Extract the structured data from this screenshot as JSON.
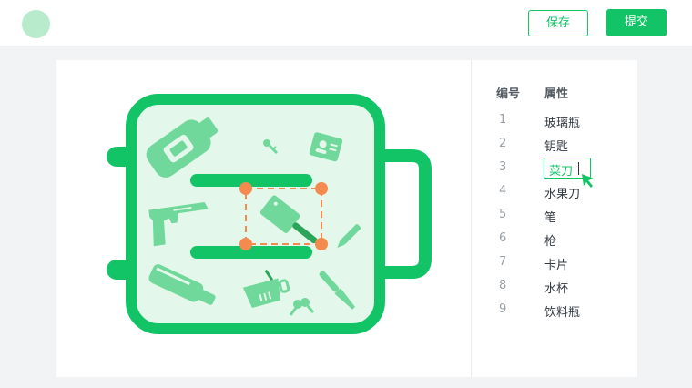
{
  "header": {
    "save_label": "保存",
    "submit_label": "提交"
  },
  "table": {
    "col_number": "编号",
    "col_attribute": "属性",
    "rows": [
      {
        "num": "1",
        "value": "玻璃瓶"
      },
      {
        "num": "2",
        "value": "钥匙"
      },
      {
        "num": "3",
        "value": "菜刀"
      },
      {
        "num": "4",
        "value": "水果刀"
      },
      {
        "num": "5",
        "value": "笔"
      },
      {
        "num": "6",
        "value": "枪"
      },
      {
        "num": "7",
        "value": "卡片"
      },
      {
        "num": "8",
        "value": "水杯"
      },
      {
        "num": "9",
        "value": "饮料瓶"
      }
    ],
    "editing_row": 3
  },
  "colors": {
    "accent": "#13c466",
    "accent_light": "#e3f7ea",
    "item_fill": "#6fd89a",
    "selection_handle": "#f58a4e"
  },
  "icons": [
    "bottle-icon",
    "key-icon",
    "id-card-icon",
    "pistol-icon",
    "cleaver-icon",
    "pen-icon",
    "glass-bottle-icon",
    "cup-icon",
    "keys-icon",
    "fruit-knife-icon",
    "cursor-icon"
  ]
}
